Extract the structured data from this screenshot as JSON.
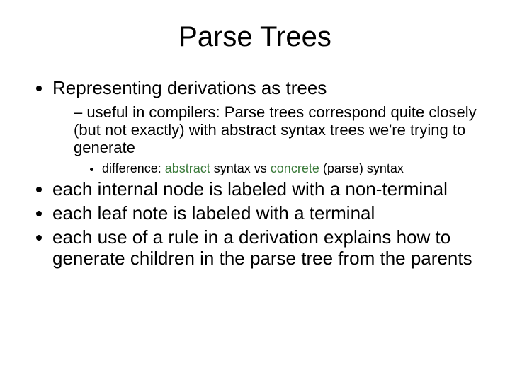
{
  "title": "Parse Trees",
  "bullets": {
    "b1": "Representing derivations as trees",
    "b1_sub": "useful in compilers:  Parse trees correspond quite closely (but not exactly) with abstract syntax trees we're trying to generate",
    "b1_sub_sub_prefix": "difference: ",
    "b1_sub_sub_a": "abstract",
    "b1_sub_sub_mid": " syntax vs ",
    "b1_sub_sub_b": "concrete",
    "b1_sub_sub_suffix": " (parse) syntax",
    "b2": "each internal node is labeled with a non-terminal",
    "b3": "each leaf note is labeled with a terminal",
    "b4": "each use of a rule in a derivation explains how to generate children in the parse tree from the parents"
  }
}
